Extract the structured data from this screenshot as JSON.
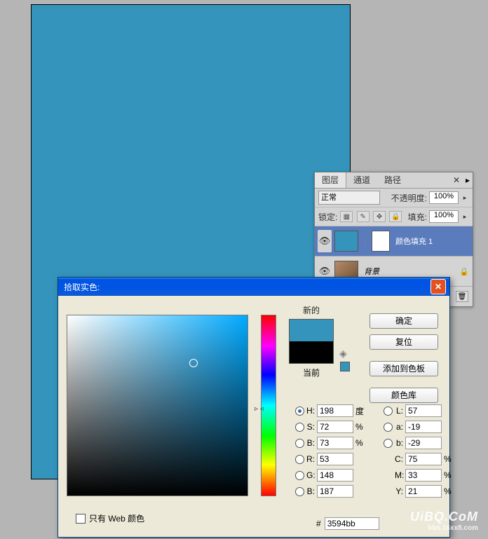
{
  "canvas": {
    "fill": "#3594bb"
  },
  "layers_panel": {
    "tabs": {
      "layers": "图层",
      "channels": "通道",
      "paths": "路径"
    },
    "close_glyph": "✕",
    "menu_glyph": "▸",
    "blend": "正常",
    "opacity_label": "不透明度:",
    "opacity_value": "100%",
    "lock_label": "锁定:",
    "fill_label": "填充:",
    "fill_value": "100%",
    "eye": "👁",
    "link_glyph": "⋮",
    "layer1_name": "颜色填充 1",
    "layer2_name": "背景",
    "lock_glyph": "🔒",
    "trash_glyph": "🗑"
  },
  "color_dialog": {
    "title": "拾取实色:",
    "close": "✕",
    "new_label": "新的",
    "current_label": "当前",
    "cube": "◈",
    "buttons": {
      "ok": "确定",
      "reset": "复位",
      "add": "添加到色板",
      "lib": "颜色库"
    },
    "H": {
      "label": "H:",
      "value": "198",
      "unit": "度"
    },
    "S": {
      "label": "S:",
      "value": "72",
      "unit": "%"
    },
    "B": {
      "label": "B:",
      "value": "73",
      "unit": "%"
    },
    "R": {
      "label": "R:",
      "value": "53"
    },
    "G": {
      "label": "G:",
      "value": "148"
    },
    "Bb": {
      "label": "B:",
      "value": "187"
    },
    "L": {
      "label": "L:",
      "value": "57"
    },
    "a": {
      "label": "a:",
      "value": "-19"
    },
    "b": {
      "label": "b:",
      "value": "-29"
    },
    "C": {
      "label": "C:",
      "value": "75",
      "unit": "%"
    },
    "M": {
      "label": "M:",
      "value": "33",
      "unit": "%"
    },
    "Y": {
      "label": "Y:",
      "value": "21",
      "unit": "%"
    },
    "hex_label": "#",
    "hex_value": "3594bb",
    "web_only": "只有 Web 颜色"
  },
  "watermark": {
    "main": "UiBQ.CoM",
    "sub": "bbs.16xx8.com"
  }
}
